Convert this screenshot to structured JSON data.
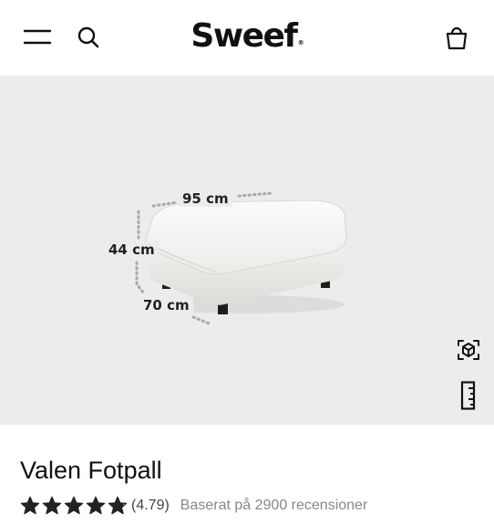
{
  "header": {
    "brand": "Sweef",
    "brand_mark": "®",
    "icons": [
      "menu-icon",
      "search-icon",
      "shopping-bag-icon"
    ]
  },
  "gallery": {
    "image": "white ottoman product photo",
    "dimensions": {
      "width": "95 cm",
      "height": "44 cm",
      "depth": "70 cm"
    },
    "side_icons": [
      "ar-view-icon",
      "ruler-icon"
    ]
  },
  "product": {
    "title": "Valen Fotpall",
    "rating_value": "(4.79)",
    "rating_stars": 4.79,
    "reviews_text": "Baserat på 2900 recensioner"
  },
  "colors": {
    "background": "#ffffff",
    "gallery_bg": "#ececec",
    "text": "#111111",
    "muted": "#888888"
  }
}
